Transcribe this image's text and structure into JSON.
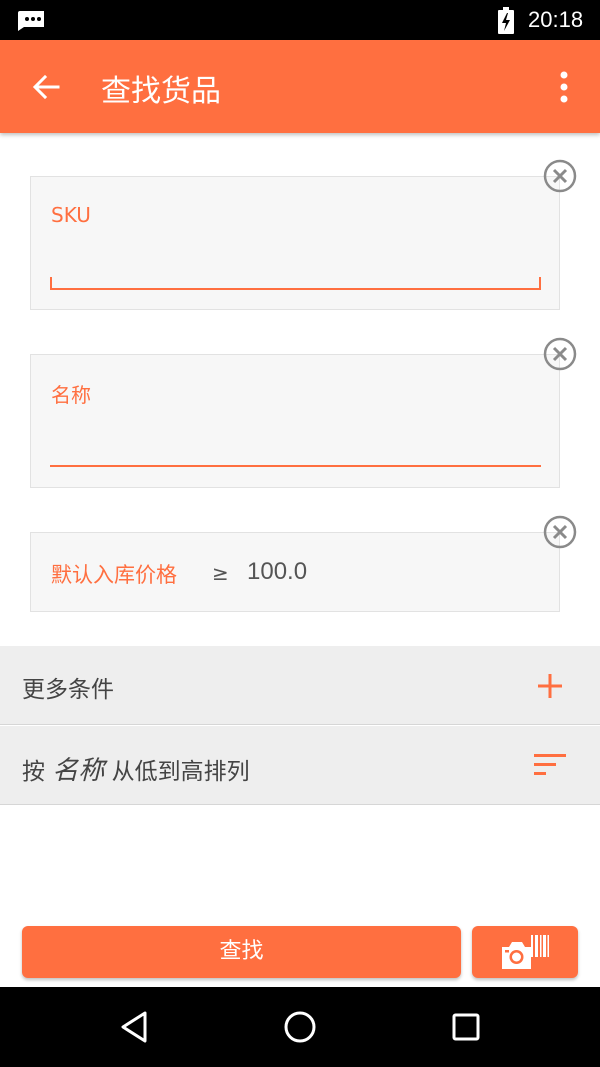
{
  "status_bar": {
    "time": "20:18",
    "notification_icon": "message-dots-icon",
    "battery_icon": "battery-charging-icon"
  },
  "app_bar": {
    "title": "查找货品",
    "back_icon": "arrow-back-icon",
    "menu_icon": "more-vert-icon",
    "color": "#ff6f40"
  },
  "fields": {
    "sku": {
      "label": "SKU",
      "value": ""
    },
    "name": {
      "label": "名称",
      "value": ""
    },
    "price": {
      "label": "默认入库价格",
      "operator": "≥",
      "value": "100.0"
    }
  },
  "options": {
    "more_conditions": "更多条件",
    "sort_prefix": "按",
    "sort_field": "名称",
    "sort_suffix": "从低到高排列"
  },
  "actions": {
    "search_label": "查找",
    "scan_icon": "camera-barcode-icon"
  },
  "nav_bar": {
    "back_icon": "nav-back-triangle-icon",
    "home_icon": "nav-home-circle-icon",
    "recents_icon": "nav-recents-square-icon"
  }
}
